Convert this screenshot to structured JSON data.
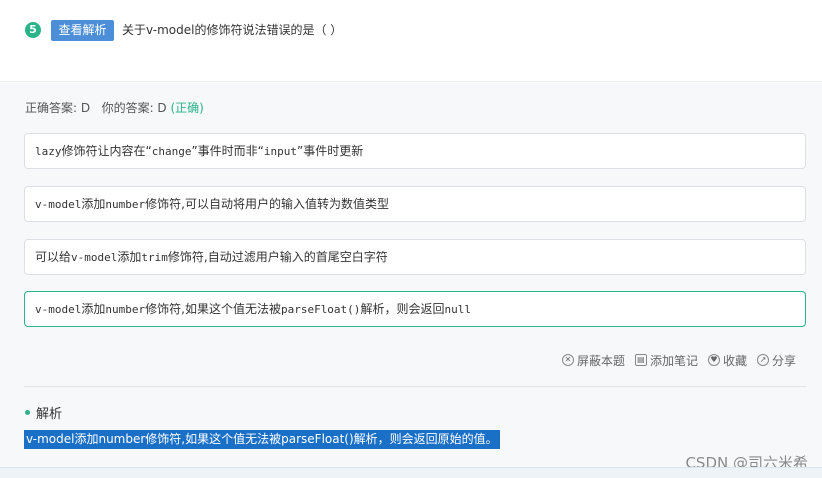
{
  "question": {
    "number": "5",
    "explain_button": "查看解析",
    "title": "关于v-model的修饰符说法错误的是（  ）"
  },
  "answer": {
    "correct_label": "正确答案: D",
    "yours_label": "你的答案: D",
    "status": "(正确)"
  },
  "options": [
    {
      "p1": "lazy",
      "p2": "修饰符让内容在“",
      "p3": "change",
      "p4": "”事件时而非“",
      "p5": "input",
      "p6": "”事件时更新"
    },
    {
      "p1": "v-model",
      "p2": "添加",
      "p3": "number",
      "p4": "修饰符,可以自动将用户的输入值转为数值类型"
    },
    {
      "p1": "可以给",
      "p2": "v-model",
      "p3": "添加",
      "p4": "trim",
      "p5": "修饰符,自动过滤用户输入的首尾空白字符"
    },
    {
      "p1": "v-model",
      "p2": "添加",
      "p3": "number",
      "p4": "修饰符,如果这个值无法被",
      "p5": "parseFloat()",
      "p6": "解析，则会返回",
      "p7": "null"
    }
  ],
  "actions": {
    "block": "屏蔽本题",
    "note": "添加笔记",
    "favorite": "收藏",
    "share": "分享"
  },
  "analysis": {
    "title": "解析",
    "text": "v-model添加number修饰符,如果这个值无法被parseFloat()解析，则会返回原始的值。"
  },
  "watermark": "CSDN @司六米希",
  "colors": {
    "accent_green": "#2bb38a",
    "button_blue": "#4c8fd8",
    "highlight_blue": "#1a6fc7"
  },
  "icons": {
    "block": "block-icon",
    "note": "notebook-icon",
    "favorite": "heart-icon",
    "share": "share-icon"
  }
}
